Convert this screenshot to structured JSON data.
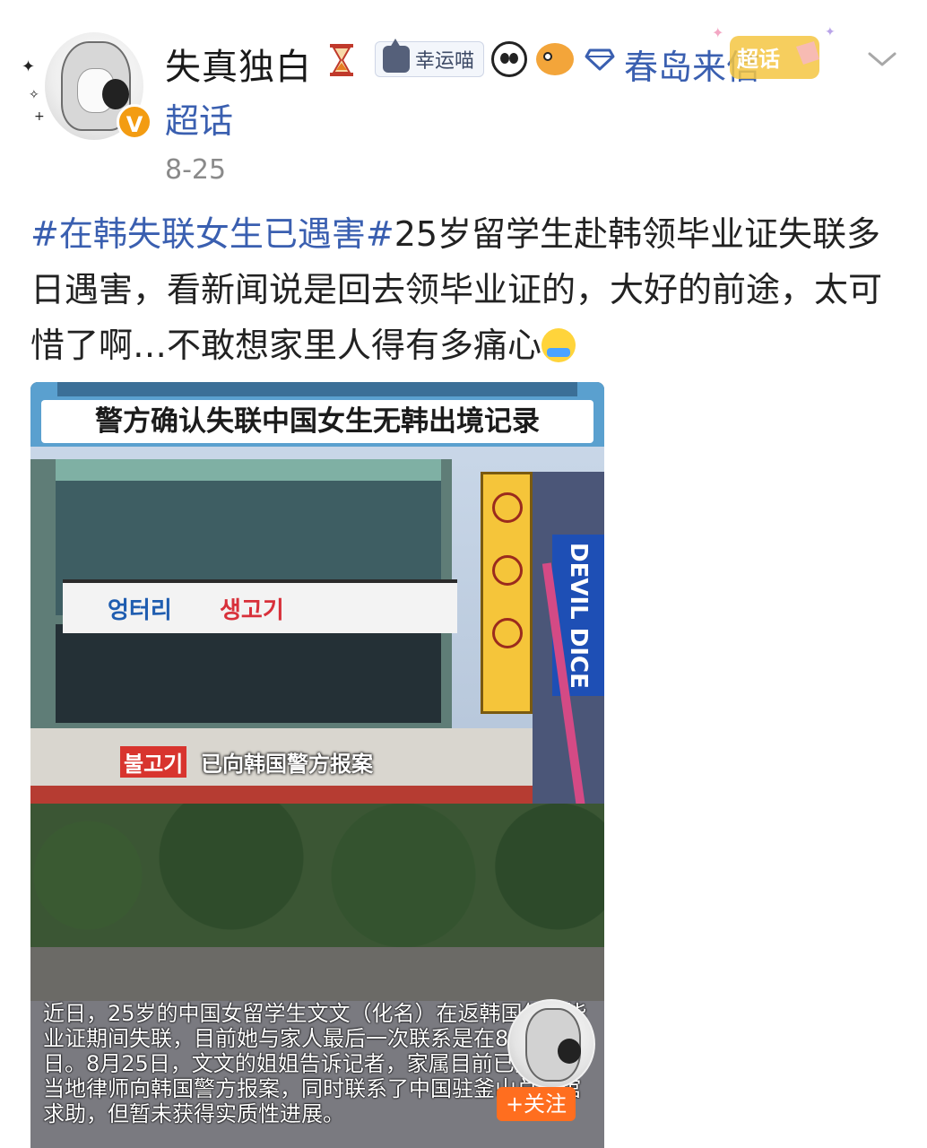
{
  "post": {
    "author": {
      "username": "失真独白",
      "verified_badge": "V",
      "badge_label": "幸运喵",
      "topic": "春岛来信",
      "supertalk": "超话",
      "date": "8-25"
    },
    "body": {
      "hashtag": "#在韩失联女生已遇害#",
      "text": "25岁留学生赴韩领毕业证失联多日遇害，看新闻说是回去领毕业证的，大好的前途，太可惜了啊…不敢想家里人得有多痛心"
    },
    "media": {
      "news_title": "警方确认失联中国女生无韩出境记录",
      "store_sign_part1": "엉터리",
      "store_sign_part2": "생고기",
      "dice_sign": "DEVIL DICE",
      "red_caption": "불고기",
      "subtitle_caption": "已向韩国警方报案",
      "caption_text": "近日，25岁的中国女留学生文文（化名）在返韩国领取毕业证期间失联，目前她与家人最后一次联系是在8月19日。8月25日，文文的姐姐告诉记者，家属目前已委托了当地律师向韩国警方报案，同时联系了中国驻釜山总领馆求助，但暂未获得实质性进展。",
      "follow_label": "+关注"
    }
  },
  "icons": {
    "hourglass": "hourglass-icon",
    "cat": "cat-icon",
    "panda": "panda-icon",
    "fish": "pufferfish-icon",
    "diamond": "diamond-icon",
    "chevron": "chevron-down-icon",
    "cry": "crying-face-icon"
  },
  "colors": {
    "link_blue": "#3a5fb0",
    "follow_orange": "#ff6e1f",
    "verified_orange": "#f39c12"
  }
}
